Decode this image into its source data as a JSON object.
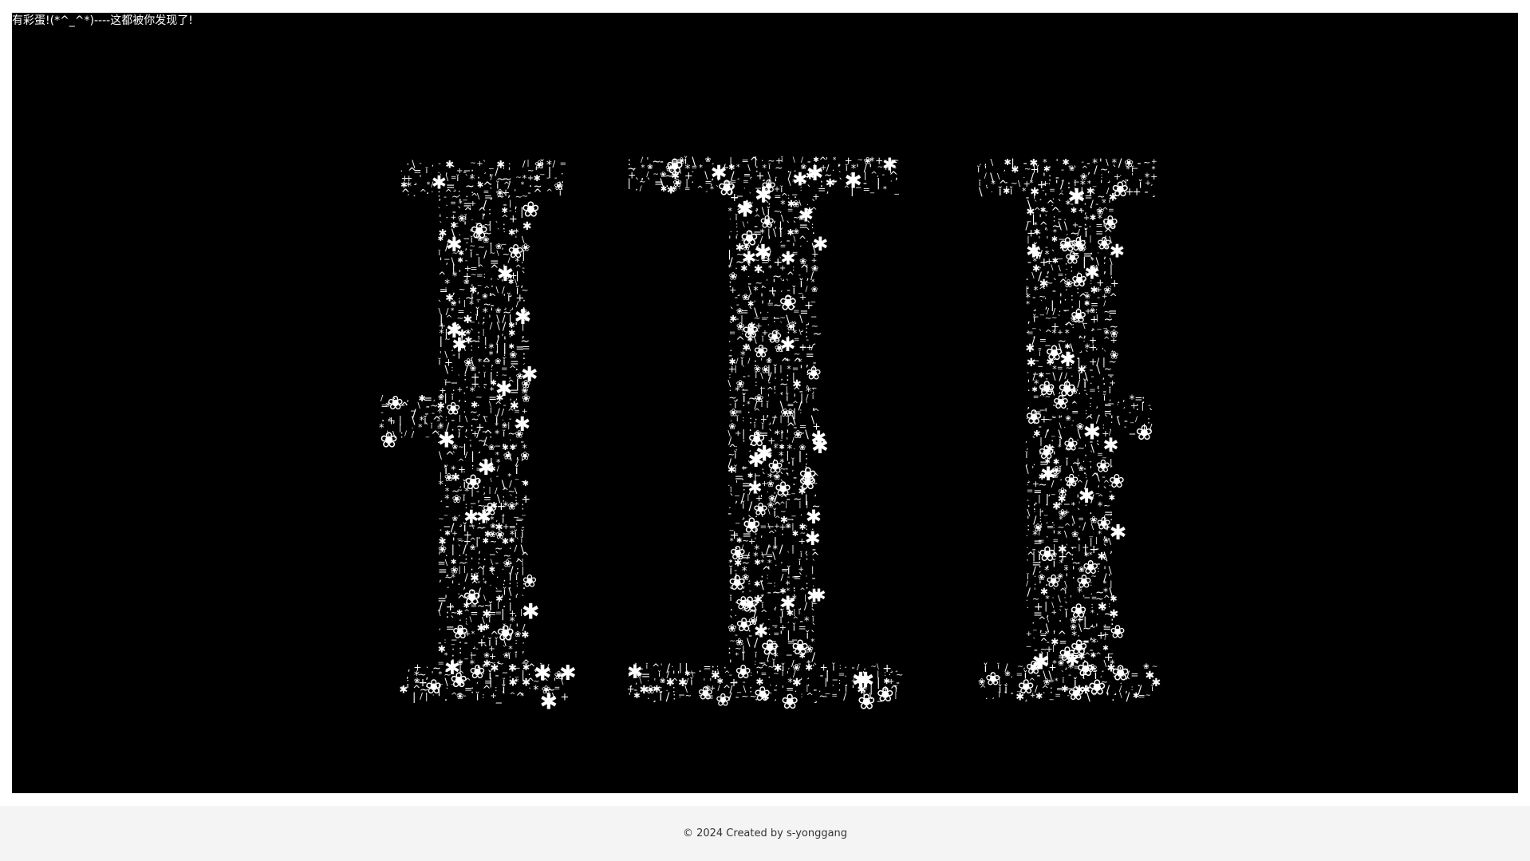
{
  "easter_egg_text": "有彩蛋!(*^_^*)----这都被你发现了!",
  "art": {
    "glyph_set": [
      "*",
      "❀",
      "✱",
      "/",
      "-",
      "=",
      "+",
      "~",
      ":",
      ".",
      ",",
      "'",
      "`",
      "^",
      "_",
      "|",
      "\\",
      "¸",
      "·",
      "ǐ"
    ],
    "large_glyphs": [
      "❀",
      "✱"
    ],
    "foreground_color": "#ffffff",
    "background_color": "#000000"
  },
  "footer": {
    "text": "© 2024 Created by s-yonggang",
    "background_color": "#f4f4f4",
    "text_color": "#333333"
  }
}
